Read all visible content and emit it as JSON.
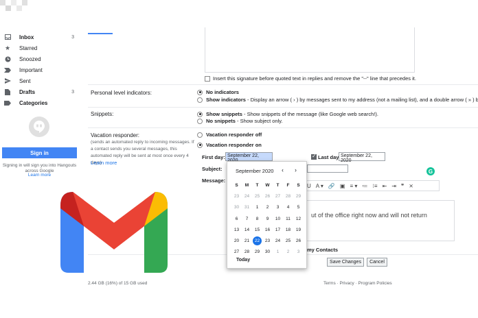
{
  "sidebar": {
    "items": [
      {
        "label": "Inbox",
        "count": "3",
        "icon": "inbox-icon",
        "bold": true
      },
      {
        "label": "Starred",
        "count": "",
        "icon": "star-icon",
        "bold": false
      },
      {
        "label": "Snoozed",
        "count": "",
        "icon": "clock-icon",
        "bold": false
      },
      {
        "label": "Important",
        "count": "",
        "icon": "important-icon",
        "bold": false
      },
      {
        "label": "Sent",
        "count": "",
        "icon": "send-icon",
        "bold": false
      },
      {
        "label": "Drafts",
        "count": "3",
        "icon": "draft-icon",
        "bold": true
      },
      {
        "label": "Categories",
        "count": "",
        "icon": "label-icon",
        "bold": true
      }
    ],
    "hangouts": {
      "signin": "Sign in",
      "text": "Signing in will sign you into Hangouts across Google",
      "learn_more": "Learn more"
    }
  },
  "signature": {
    "checkbox_label": "Insert this signature before quoted text in replies and remove the \"--\" line that precedes it."
  },
  "indicators": {
    "label": "Personal level indicators:",
    "opt1": "No indicators",
    "opt2_bold": "Show indicators",
    "opt2_desc": " - Display an arrow ( › ) by messages sent to my address (not a mailing list), and a double arrow ( » ) by mess"
  },
  "snippets": {
    "label": "Snippets:",
    "opt1_bold": "Show snippets",
    "opt1_desc": " - Show snippets of the message (like Google web search!).",
    "opt2_bold": "No snippets",
    "opt2_desc": " - Show subject only."
  },
  "vacation": {
    "label": "Vacation responder:",
    "desc": "(sends an automated reply to incoming messages. If a contact sends you several messages, this automated reply will be sent at most once every 4 days)",
    "learn_more": "Learn more",
    "off": "Vacation responder off",
    "on": "Vacation responder on",
    "first_day_label": "First day:",
    "first_day_value": "September 22, 2020",
    "last_day_label": "Last day:",
    "last_day_value": "September 22, 2020",
    "subject_label": "Subject:",
    "message_label": "Message:",
    "message_text": "ut of the office right now and will not return",
    "contacts_text": "my Contacts"
  },
  "datepicker": {
    "title": "September 2020",
    "prev": "‹",
    "next": "›",
    "weekdays": [
      "S",
      "M",
      "T",
      "W",
      "T",
      "F",
      "S"
    ],
    "weeks": [
      [
        "23",
        "24",
        "25",
        "26",
        "27",
        "28",
        "29"
      ],
      [
        "30",
        "31",
        "1",
        "2",
        "3",
        "4",
        "5"
      ],
      [
        "6",
        "7",
        "8",
        "9",
        "10",
        "11",
        "12"
      ],
      [
        "13",
        "14",
        "15",
        "16",
        "17",
        "18",
        "19"
      ],
      [
        "20",
        "21",
        "22",
        "23",
        "24",
        "25",
        "26"
      ],
      [
        "27",
        "28",
        "29",
        "30",
        "1",
        "2",
        "3"
      ]
    ],
    "selected": "22",
    "today": "Today"
  },
  "toolbar": {
    "items": [
      "U",
      "A ▾",
      "🔗",
      "▣",
      "≡ ▾",
      "≔",
      "⁝≡",
      "⇤",
      "⇥",
      "❞",
      "⨯"
    ]
  },
  "buttons": {
    "save": "Save Changes",
    "cancel": "Cancel"
  },
  "footer": {
    "storage": "2.44 GB (16%) of 15 GB used",
    "links": "Terms · Privacy · Program Policies"
  },
  "colors": {
    "accent": "#1a73e8",
    "gmail_red": "#ea4335",
    "gmail_blue": "#4285f4",
    "gmail_green": "#34a853",
    "gmail_yellow": "#fbbc04",
    "gmail_darkred": "#c5221f"
  }
}
